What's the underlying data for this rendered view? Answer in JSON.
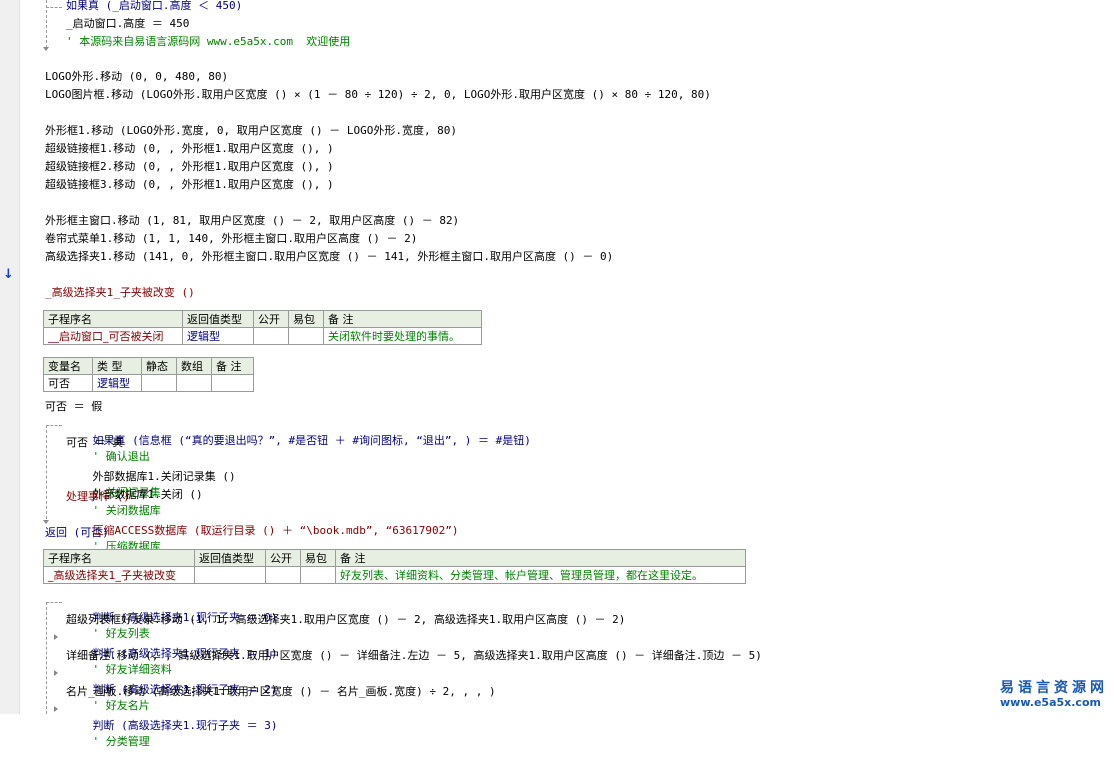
{
  "colors": {
    "keyword": "#000080",
    "function": "#800000",
    "string": "#006060",
    "comment": "#008000",
    "table_header": "#e6efe1",
    "watermark": "#1858b0"
  },
  "gutter": {
    "marker_icon": "down-arrow-icon",
    "marker": "↓"
  },
  "lines": {
    "l01": "如果真 (_启动窗口.高度 ＜ 450)",
    "l02": "_启动窗口.高度 ＝ 450",
    "l03": "' 本源码来自易语言源码网 www.e5a5x.com  欢迎使用",
    "l04": "LOGO外形.移动 (0, 0, 480, 80)",
    "l05": "LOGO图片框.移动 (LOGO外形.取用户区宽度 () × (1 － 80 ÷ 120) ÷ 2, 0, LOGO外形.取用户区宽度 () × 80 ÷ 120, 80)",
    "l06": "外形框1.移动 (LOGO外形.宽度, 0, 取用户区宽度 () － LOGO外形.宽度, 80)",
    "l07": "超级链接框1.移动 (0, , 外形框1.取用户区宽度 (), )",
    "l08": "超级链接框2.移动 (0, , 外形框1.取用户区宽度 (), )",
    "l09": "超级链接框3.移动 (0, , 外形框1.取用户区宽度 (), )",
    "l10": "外形框主窗口.移动 (1, 81, 取用户区宽度 () － 2, 取用户区高度 () － 82)",
    "l11": "卷帘式菜单1.移动 (1, 1, 140, 外形框主窗口.取用户区高度 () － 2)",
    "l12": "高级选择夹1.移动 (141, 0, 外形框主窗口.取用户区宽度 () － 141, 外形框主窗口.取用户区高度 () － 0)",
    "l13": "_高级选择夹1_子夹被改变 ()",
    "l14": "可否 ＝ 假",
    "l15a": "如果真 (信息框 (“真的要退出吗？”, #是否钮 ＋ #询问图标, “退出”, ) ＝ #是钮)",
    "l15b": "' 确认退出",
    "l16": "可否 ＝ 真",
    "l17a": "外部数据库1.关闭记录集 ()",
    "l17b": "' 关闭记录集",
    "l18a": "外部数据库1.关闭 ()",
    "l18b": "' 关闭数据库",
    "l19": "处理事件 ()",
    "l20a": "压缩ACCESS数据库 (取运行目录 () ＋ “\\book.mdb”, “63617902”)",
    "l20b": "' 压缩数据库",
    "l21": "返回 (可否)",
    "l22a": "判断 (高级选择夹1.现行子夹 ＝ 0)",
    "l22b": "' 好友列表",
    "l23": "超级列表框好友录.移动 (1, 1, 高级选择夹1.取用户区宽度 () － 2, 高级选择夹1.取用户区高度 () － 2)",
    "l24a": "判断 (高级选择夹1.现行子夹 ＝ 1)",
    "l24b": "' 好友详细资料",
    "l25": "详细备注.移动 (, , 高级选择夹1.取用户区宽度 () － 详细备注.左边 － 5, 高级选择夹1.取用户区高度 () － 详细备注.顶边 － 5)",
    "l26a": "判断 (高级选择夹1.现行子夹 ＝ 2)",
    "l26b": "' 好友名片",
    "l27": "名片_画板.移动 (高级选择夹1.取用户区宽度 () － 名片_画板.宽度) ÷ 2, , , )",
    "l28a": "判断 (高级选择夹1.现行子夹 ＝ 3)",
    "l28b": "' 分类管理"
  },
  "sub1": {
    "headers": [
      "子程序名",
      "返回值类型",
      "公开",
      "易包",
      "备 注"
    ],
    "row": [
      "__启动窗口_可否被关闭",
      "逻辑型",
      "",
      "",
      "关闭软件时要处理的事情。"
    ]
  },
  "vars1": {
    "headers": [
      "变量名",
      "类 型",
      "静态",
      "数组",
      "备 注"
    ],
    "row": [
      "可否",
      "逻辑型",
      "",
      "",
      ""
    ]
  },
  "sub2": {
    "headers": [
      "子程序名",
      "返回值类型",
      "公开",
      "易包",
      "备 注"
    ],
    "row": [
      "_高级选择夹1_子夹被改变",
      "",
      "",
      "",
      "好友列表、详细资料、分类管理、帐户管理、管理员管理，都在这里设定。"
    ]
  },
  "watermark": {
    "title": "易语言资源网",
    "url": "www.e5a5x.com"
  }
}
